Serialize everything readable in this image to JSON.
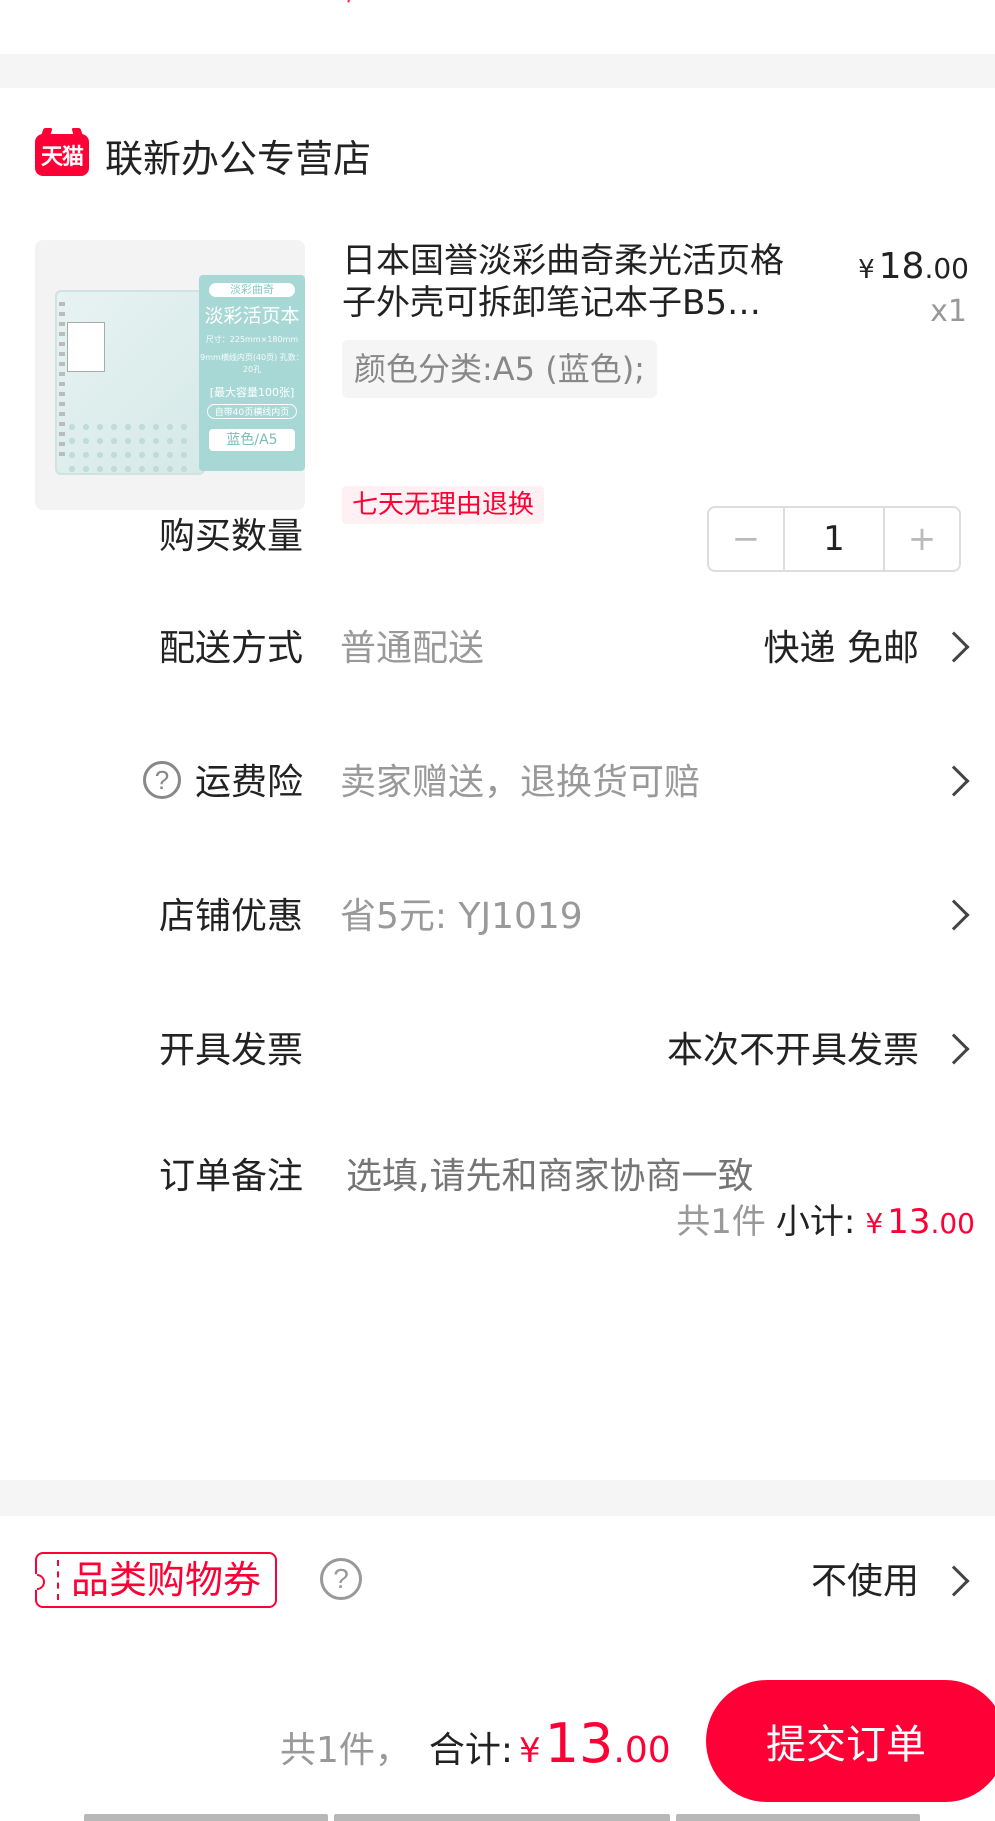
{
  "shop": {
    "badge": "天猫",
    "name": "联新办公专营店"
  },
  "product": {
    "image_text": {
      "card_top": "淡彩曲奇",
      "card_title": "淡彩活页本",
      "card_size": "尺寸：225mm×180mm",
      "card_spec": "9mm横线内页(40页) 孔数：20孔",
      "card_capacity": "[最大容量100张]",
      "card_inner": "自带40页横线内页",
      "card_color": "蓝色/A5"
    },
    "title": "日本国誉淡彩曲奇柔光活页格子外壳可拆卸笔记本子B5…",
    "price_symbol": "¥",
    "price_int": "18",
    "price_dec": ".00",
    "quantity": "x1",
    "sku": "颜色分类:A5 (蓝色);",
    "return_policy": "七天无理由退换"
  },
  "rows": {
    "quantity": {
      "label": "购买数量",
      "minus": "−",
      "value": "1",
      "plus": "+"
    },
    "delivery": {
      "label": "配送方式",
      "desc": "普通配送",
      "value": "快递 免邮"
    },
    "insurance": {
      "icon": "?",
      "label": "运费险",
      "desc": "卖家赠送，退换货可赔"
    },
    "discount": {
      "label": "店铺优惠",
      "desc": "省5元: YJ1019"
    },
    "invoice": {
      "label": "开具发票",
      "value": "本次不开具发票"
    },
    "note": {
      "label": "订单备注",
      "placeholder": "选填,请先和商家协商一致"
    }
  },
  "subtotal": {
    "count": "共1件",
    "label": "小计:",
    "symbol": "¥",
    "int": "13",
    "dec": ".00"
  },
  "coupon": {
    "badge": "品类购物券",
    "help": "?",
    "value": "不使用"
  },
  "footer": {
    "count": "共1件，",
    "label": "合计:",
    "symbol": "¥",
    "int": "13",
    "dec": ".00",
    "submit": "提交订单"
  },
  "colors": {
    "accent": "#ff0036",
    "text": "#222222",
    "muted": "#999999",
    "divider_bg": "#f5f5f5"
  }
}
